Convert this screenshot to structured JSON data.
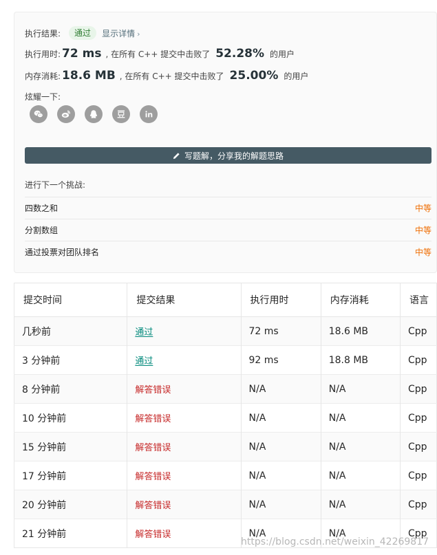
{
  "result": {
    "result_label": "执行结果:",
    "status": "通过",
    "details_link": "显示详情",
    "runtime_label": "执行用时:",
    "runtime_value": "72 ms",
    "runtime_text": ", 在所有 C++ 提交中击败了",
    "runtime_percent": "52.28%",
    "runtime_users": "的用户",
    "memory_label": "内存消耗:",
    "memory_value": "18.6 MB",
    "memory_text": ", 在所有 C++ 提交中击败了",
    "memory_percent": "25.00%",
    "memory_users": "的用户",
    "share_label": "炫耀一下:",
    "share_icons": [
      "wechat-icon",
      "weibo-icon",
      "qq-icon",
      "douban-icon",
      "linkedin-icon"
    ]
  },
  "write_solution": {
    "label": "写题解，分享我的解题思路"
  },
  "challenges": {
    "title": "进行下一个挑战:",
    "items": [
      {
        "name": "四数之和",
        "difficulty": "中等"
      },
      {
        "name": "分割数组",
        "difficulty": "中等"
      },
      {
        "name": "通过投票对团队排名",
        "difficulty": "中等"
      }
    ]
  },
  "submissions": {
    "headers": [
      "提交时间",
      "提交结果",
      "执行用时",
      "内存消耗",
      "语言"
    ],
    "rows": [
      {
        "time": "几秒前",
        "result": "通过",
        "runtime": "72 ms",
        "memory": "18.6 MB",
        "lang": "Cpp",
        "ok": true
      },
      {
        "time": "3 分钟前",
        "result": "通过",
        "runtime": "92 ms",
        "memory": "18.8 MB",
        "lang": "Cpp",
        "ok": true
      },
      {
        "time": "8 分钟前",
        "result": "解答错误",
        "runtime": "N/A",
        "memory": "N/A",
        "lang": "Cpp",
        "ok": false
      },
      {
        "time": "10 分钟前",
        "result": "解答错误",
        "runtime": "N/A",
        "memory": "N/A",
        "lang": "Cpp",
        "ok": false
      },
      {
        "time": "15 分钟前",
        "result": "解答错误",
        "runtime": "N/A",
        "memory": "N/A",
        "lang": "Cpp",
        "ok": false
      },
      {
        "time": "17 分钟前",
        "result": "解答错误",
        "runtime": "N/A",
        "memory": "N/A",
        "lang": "Cpp",
        "ok": false
      },
      {
        "time": "20 分钟前",
        "result": "解答错误",
        "runtime": "N/A",
        "memory": "N/A",
        "lang": "Cpp",
        "ok": false
      },
      {
        "time": "21 分钟前",
        "result": "解答错误",
        "runtime": "N/A",
        "memory": "N/A",
        "lang": "Cpp",
        "ok": false
      }
    ]
  },
  "watermark": "https://blog.csdn.net/weixin_42269817",
  "colors": {
    "accepted": "#00897b",
    "wrong": "#c62828",
    "medium": "#ef6c00",
    "button": "#455a64"
  }
}
